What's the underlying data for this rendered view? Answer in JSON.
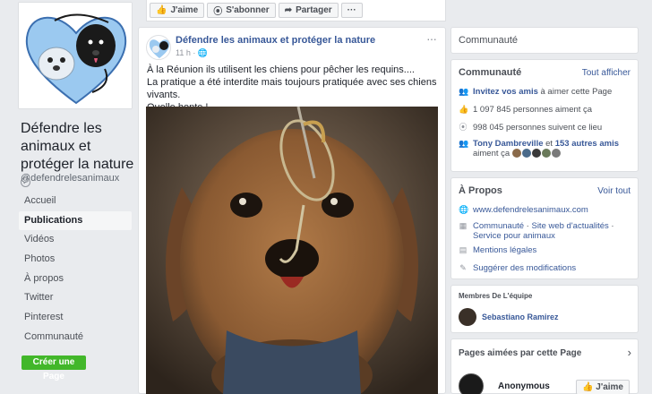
{
  "left": {
    "page_name": "Défendre les animaux et protéger la nature",
    "handle": "@defendrelesanimaux",
    "nav": [
      {
        "label": "Accueil",
        "active": false
      },
      {
        "label": "Publications",
        "active": true
      },
      {
        "label": "Vidéos",
        "active": false
      },
      {
        "label": "Photos",
        "active": false
      },
      {
        "label": "À propos",
        "active": false
      },
      {
        "label": "Twitter",
        "active": false
      },
      {
        "label": "Pinterest",
        "active": false
      },
      {
        "label": "Communauté",
        "active": false
      }
    ],
    "create_page_label": "Créer une Page"
  },
  "toolbar": {
    "like_label": "J'aime",
    "follow_label": "S'abonner",
    "share_label": "Partager",
    "more_label": "···"
  },
  "post": {
    "author": "Défendre les animaux et protéger la nature",
    "time": "11 h ·",
    "more": "···",
    "text_line1": "À la Réunion ils utilisent les chiens pour pêcher les requins....",
    "text_line2": "La pratique a été interdite mais toujours pratiquée avec ses chiens vivants.",
    "text_line3": "Quelle honte !"
  },
  "community_top": {
    "title": "Communauté"
  },
  "community": {
    "title": "Communauté",
    "see_all": "Tout afficher",
    "invite_link": "Invitez vos amis",
    "invite_rest": " à aimer cette Page",
    "likes": "1 097 845 personnes aiment ça",
    "follows": "998 045 personnes suivent ce lieu",
    "friends_name": "Tony Dambreville",
    "friends_mid": " et ",
    "friends_count": "153 autres amis",
    "friends_rest": " aiment ça"
  },
  "about": {
    "title": "À Propos",
    "see_all": "Voir tout",
    "website": "www.defendrelesanimaux.com",
    "category_1": "Communauté",
    "category_sep": " · ",
    "category_2": "Site web d'actualités",
    "category_3": "Service pour animaux",
    "legal": "Mentions légales",
    "suggest": "Suggérer des modifications"
  },
  "team": {
    "title": "Membres De L'équipe",
    "member_name": "Sebastiano Ramirez"
  },
  "liked_pages": {
    "title": "Pages aimées par cette Page",
    "page_name": "Anonymous",
    "like_label": "J'aime"
  },
  "colors": {
    "brand_blue": "#385898",
    "green": "#42b72a",
    "background": "#e9ebee"
  }
}
